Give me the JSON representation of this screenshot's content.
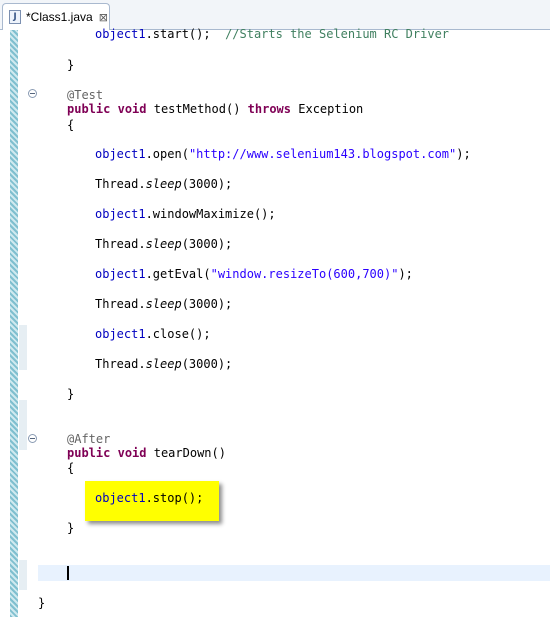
{
  "tab": {
    "icon_letter": "J",
    "label": "*Class1.java",
    "close_glyph": "⊠"
  },
  "code": {
    "start_obj": "object1",
    "start_call": ".start();  ",
    "start_comment": "//Starts the Selenium RC Driver",
    "brace_close": "}",
    "brace_open": "{",
    "ann_test": "@Test",
    "kw_public": "public",
    "kw_void": "void",
    "kw_throws": "throws",
    "test_method": " testMethod() ",
    "exception": " Exception",
    "open_call": ".open(",
    "open_url": "\"http://www.selenium143.blogspot.com\"",
    "close_paren_semi": ");",
    "thread": "Thread.",
    "sleep": "sleep",
    "sleep_args": "(3000);",
    "window_max": ".windowMaximize();",
    "get_eval": ".getEval(",
    "eval_str": "\"window.resizeTo(600,700)\"",
    "close_call": ".close();",
    "ann_after": "@After",
    "teardown": " tearDown()",
    "stop_call": ".stop();",
    "space": " "
  },
  "highlight_color": "#ffff00"
}
